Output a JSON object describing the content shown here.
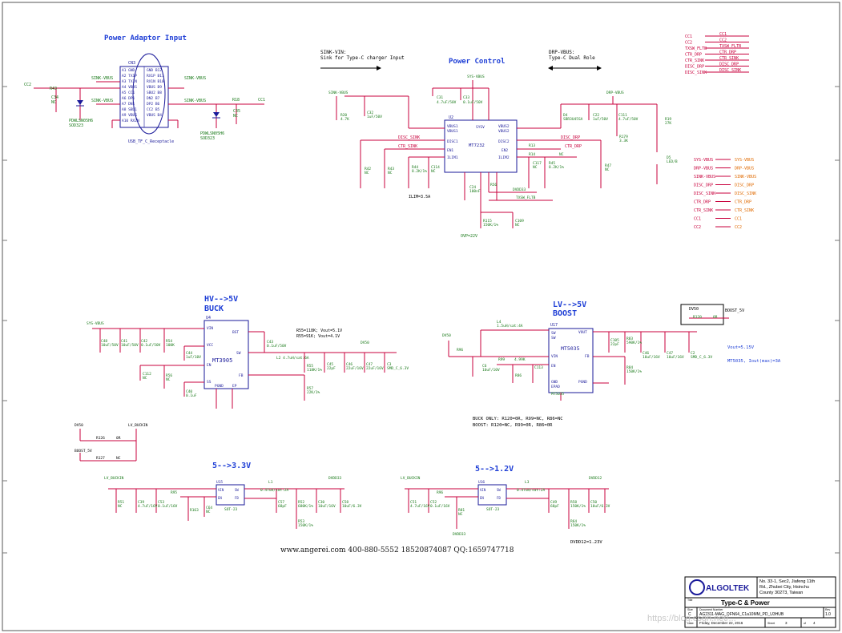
{
  "sections": {
    "power_adaptor": "Power Adaptor Input",
    "power_control": "Power Control",
    "buck_title": "HV-->5V",
    "buck_sub": "BUCK",
    "boost_title": "LV-->5V",
    "boost_sub": "BOOST",
    "ldo33": "5-->3.3V",
    "ldo12": "5-->1.2V"
  },
  "notes": {
    "sink_1": "SINK-VIN:",
    "sink_2": "Sink for Type-C charger Input",
    "drp_1": "DRP-VBUS:",
    "drp_2": "Type-C Dual Role",
    "buck_cfg1": "R55=118K; Vout=5.1V",
    "buck_cfg2": "R55=91K; Vout=4.1V",
    "vout_boost": "Vout=5.15V",
    "boost_max": "MT5035, Iout(max)=3A",
    "mode1": "BUCK ONLY: R120=0R, R99=NC, R86=NC",
    "mode2": "BOOST: R120=NC, R99=0R, R86=0R",
    "dvdd12": "DVDD12=1.23V",
    "ilim": "ILIM=3.5A",
    "ovp": "OVP=22V",
    "website": "www.angerei.com 400-880-5552 18520874087 QQ:1659747718",
    "watermark": "https://blog.csdn.net/..."
  },
  "chips": {
    "u2": "U2",
    "u2_name": "MT7232",
    "u4": "U4",
    "u4_name": "MT3905",
    "u17": "U17",
    "u17_name": "MT5035",
    "u15": "U15",
    "u16": "U16",
    "conn": "USB_TF_C_Receptacle"
  },
  "nets": {
    "sys_vbus": "SYS-VBUS",
    "drp_vbus": "DRP-VBUS",
    "sink_vbus": "SINK-VBUS",
    "disc_sink": "DISC_SINK",
    "ctr_sink": "CTR_SINK",
    "disc_drp": "DISC_DRP",
    "ctr_drp": "CTR_DRP",
    "boost_5v": "BOOST_5V",
    "dv50": "DV50",
    "lv_buckin": "LV_BUCKIN",
    "dvdd33": "DVDD33",
    "dvdd12": "DVDD12",
    "cc1": "CC1",
    "cc2": "CC2",
    "txsw": "TXSW_FLTB"
  },
  "right_netlist": [
    "SYS-VBUS",
    "DRP-VBUS",
    "SINK-VBUS",
    "DISC_DRP",
    "DISC_SINK",
    "CTR_DRP",
    "CTR_SINK",
    "CC1",
    "CC2"
  ],
  "right_netlist_out": [
    "SYS-VBUS",
    "DRP-VBUS",
    "SINK-VBUS",
    "DISC_DRP",
    "DISC_SINK",
    "CTR_DRP",
    "CTR_SINK",
    "CC1",
    "CC2"
  ],
  "top_right_nets": [
    "CC1",
    "CC2",
    "TXSW_FLTB",
    "CTR_DRP",
    "CTR_SINK",
    "DISC_DRP",
    "DISC_SINK"
  ],
  "title_block": {
    "company": "ALGOLTEK",
    "address_1": "No. 33-1, Sec2, Jiafeng 11th",
    "address_2": "Rd., Zhubei City, Hsinchu",
    "address_3": "County 30273, Taiwan",
    "title": "Type-C & Power",
    "doc_number": "AG2311-MAG_QFN64_C1a10MM_PD_U3HUB",
    "rev": "1.0",
    "date": "Friday, December 22, 2016",
    "sheet": "3",
    "of": "4",
    "size": "C"
  },
  "colors": {
    "wire": "#c8003c",
    "body": "#1a1a9a",
    "note": "#000000",
    "heading": "#1f3fd6",
    "label": "#1a7a1a",
    "orange": "#e06a00"
  }
}
